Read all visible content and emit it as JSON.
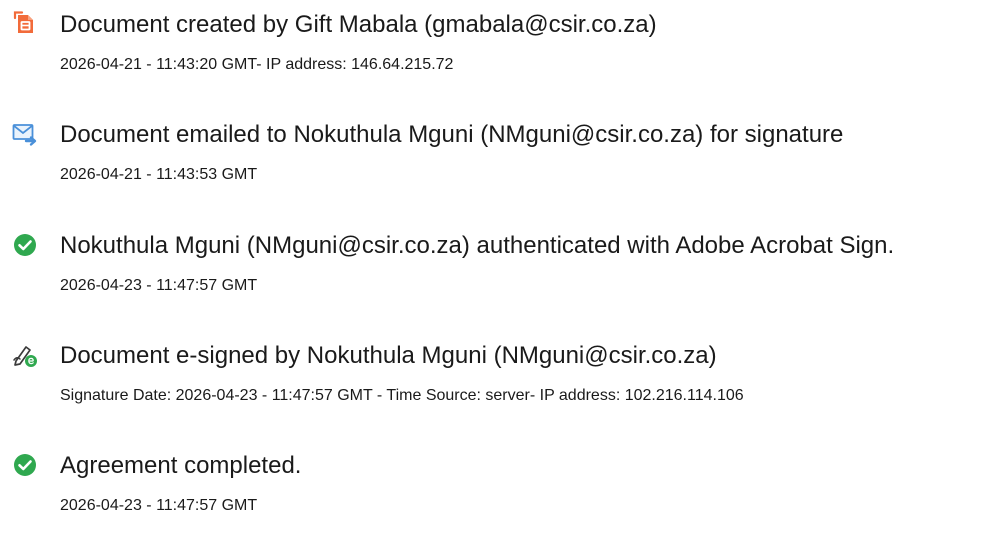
{
  "events": [
    {
      "icon": "document-created-icon",
      "title": "Document created by Gift Mabala (gmabala@csir.co.za)",
      "detail": "2026-04-21 - 11:43:20 GMT- IP address: 146.64.215.72"
    },
    {
      "icon": "email-sent-icon",
      "title": "Document emailed to Nokuthula Mguni (NMguni@csir.co.za) for signature",
      "detail": "2026-04-21 - 11:43:53 GMT"
    },
    {
      "icon": "check-circle-icon",
      "title": "Nokuthula Mguni (NMguni@csir.co.za) authenticated with Adobe Acrobat Sign.",
      "detail": "2026-04-23 - 11:47:57 GMT"
    },
    {
      "icon": "e-signature-pen-icon",
      "title": "Document e-signed by Nokuthula Mguni (NMguni@csir.co.za)",
      "detail": "Signature Date: 2026-04-23 - 11:47:57 GMT - Time Source: server- IP address: 102.216.114.106"
    },
    {
      "icon": "check-circle-icon",
      "title": "Agreement completed.",
      "detail": "2026-04-23 - 11:47:57 GMT"
    }
  ],
  "colors": {
    "orange": "#f26b3a",
    "blue": "#4a90d9",
    "green": "#2fa84f",
    "text": "#1a1a1a"
  }
}
